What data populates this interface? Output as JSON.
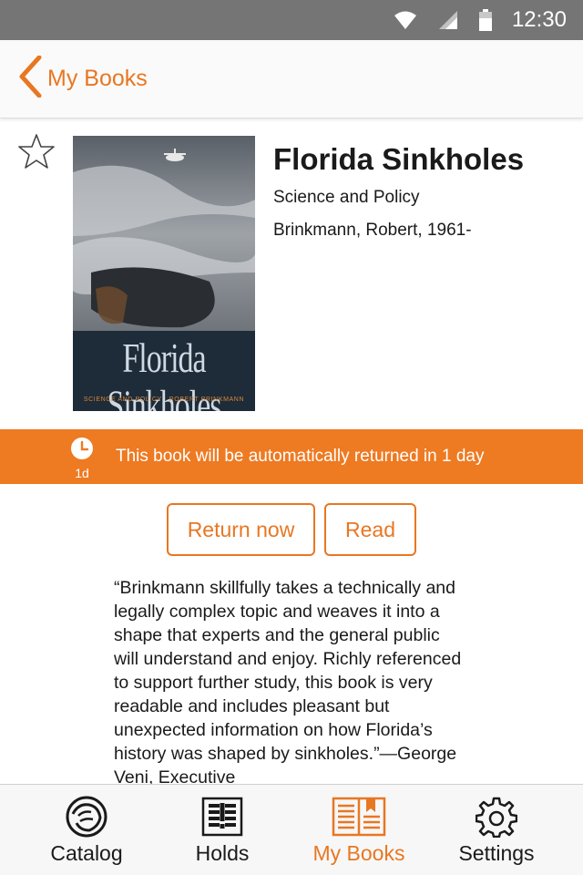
{
  "status_bar": {
    "time": "12:30",
    "icons": [
      "wifi-icon",
      "signal-icon",
      "battery-icon"
    ]
  },
  "app_bar": {
    "back_label": "My Books",
    "back_icon": "chevron-left-icon"
  },
  "book": {
    "title": "Florida Sinkholes",
    "subtitle": "Science and Policy",
    "author": "Brinkmann, Robert, 1961-",
    "cover": {
      "title": "Florida Sinkholes",
      "subtitle": "SCIENCE AND POLICY · ROBERT BRINKMANN"
    },
    "favorite_icon": "star-outline-icon"
  },
  "notice": {
    "badge": "1d",
    "icon": "clock-icon",
    "text": "This book will be automatically returned in 1 day"
  },
  "actions": {
    "return_label": "Return now",
    "read_label": "Read"
  },
  "description": "“Brinkmann skillfully takes a technically and legally complex topic and weaves it into a shape that experts and the general public will understand and enjoy. Richly referenced to support further study, this book is very readable and includes pleasant but unexpected information on how Florida’s history was shaped by sinkholes.”—George Veni, Executive",
  "tabs": [
    {
      "label": "Catalog",
      "icon": "lion-icon",
      "active": false
    },
    {
      "label": "Holds",
      "icon": "holds-icon",
      "active": false
    },
    {
      "label": "My Books",
      "icon": "my-books-icon",
      "active": true
    },
    {
      "label": "Settings",
      "icon": "gear-icon",
      "active": false
    }
  ],
  "colors": {
    "accent": "#ee7a22",
    "status_bar": "#757575",
    "text": "#1a1a1a"
  }
}
